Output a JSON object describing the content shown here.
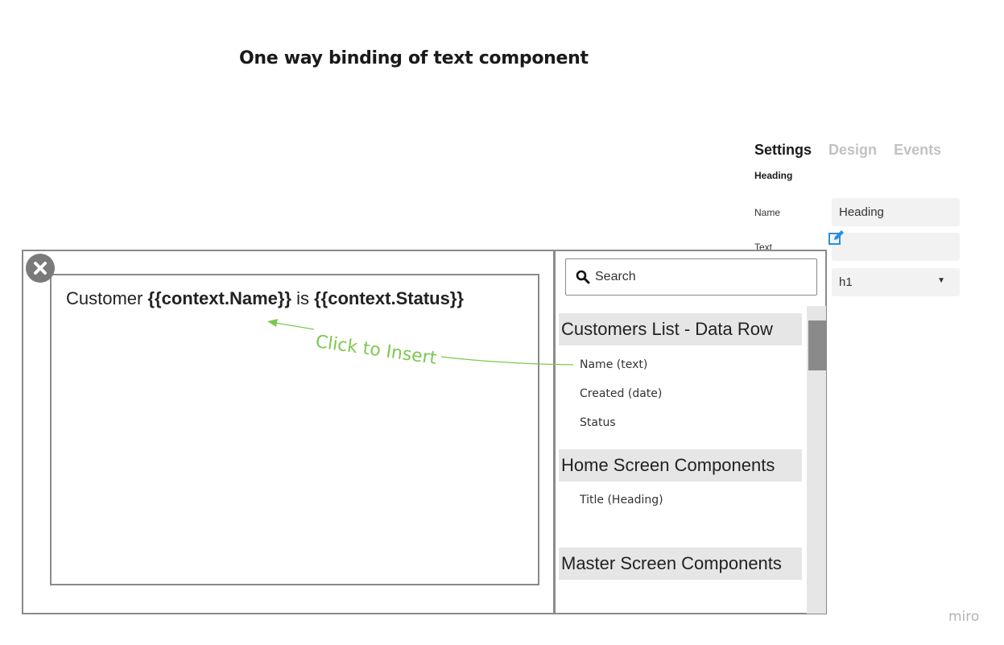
{
  "page_title": "One way binding of text component",
  "settings": {
    "tabs": [
      {
        "label": "Settings",
        "active": true
      },
      {
        "label": "Design",
        "active": false
      },
      {
        "label": "Events",
        "active": false
      }
    ],
    "section_title": "Heading",
    "fields": {
      "name_label": "Name",
      "name_value": "Heading",
      "text_label": "Text",
      "text_value": "",
      "level_value": "h1"
    }
  },
  "dialog": {
    "editor_text": {
      "prefix": "Customer ",
      "binding_name": "{{context.Name}}",
      "middle": " is ",
      "binding_status": "{{context.Status}}"
    },
    "search_placeholder": "Search",
    "groups": [
      {
        "title": "Customers List - Data Row",
        "items": [
          "Name (text)",
          "Created (date)",
          "Status"
        ]
      },
      {
        "title": "Home Screen Components",
        "items": [
          "Title (Heading)"
        ]
      },
      {
        "title": "Master Screen Components",
        "items": []
      }
    ]
  },
  "hint": "Click to Insert",
  "watermark": "miro",
  "colors": {
    "accent_green": "#7ec850",
    "edit_icon_blue": "#2b8fe0",
    "border_gray": "#8a8a8a"
  }
}
